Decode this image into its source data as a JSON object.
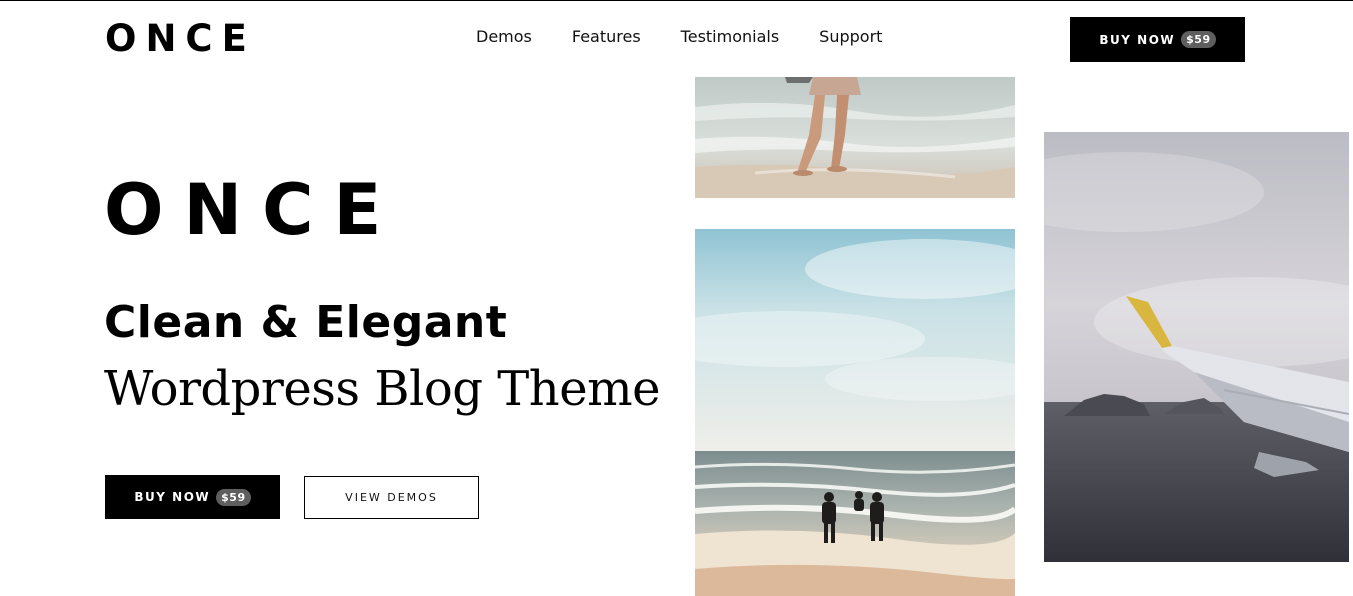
{
  "header": {
    "logo": "ONCE",
    "nav": [
      {
        "label": "Demos"
      },
      {
        "label": "Features"
      },
      {
        "label": "Testimonials"
      },
      {
        "label": "Support"
      }
    ],
    "buy_label": "BUY NOW",
    "buy_price": "$59"
  },
  "hero": {
    "logo": "ONCE",
    "headline_line1": "Clean & Elegant",
    "headline_line2": "Wordpress Blog Theme",
    "buy_label": "BUY NOW",
    "buy_price": "$59",
    "demos_label": "VIEW DEMOS"
  },
  "gallery": {
    "images": [
      {
        "subject": "woman walking in beach surf"
      },
      {
        "subject": "three people running into the sea"
      },
      {
        "subject": "airplane wing above sea and islands"
      }
    ]
  },
  "colors": {
    "primary": "#000000",
    "background": "#ffffff",
    "price_badge": "#5e5e5e"
  }
}
